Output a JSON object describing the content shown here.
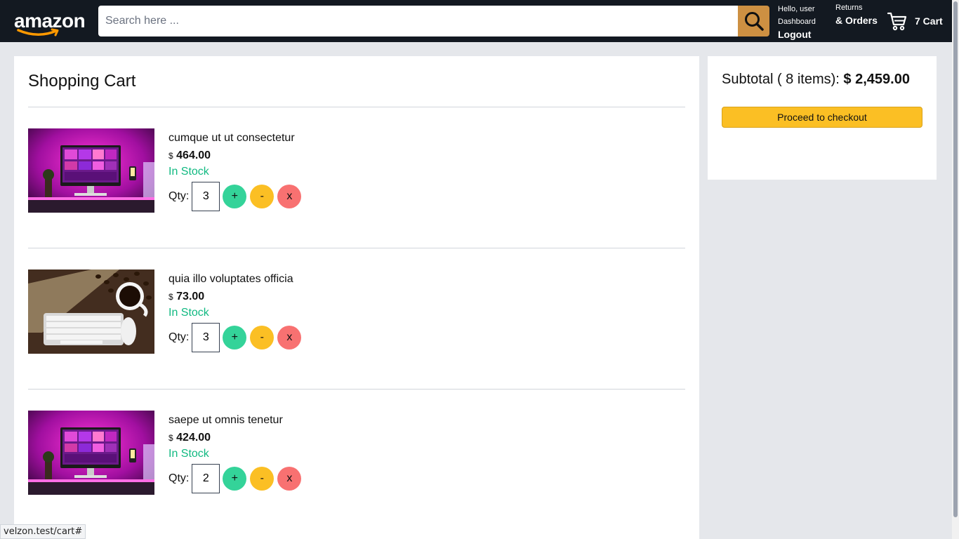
{
  "header": {
    "logo_text": "amazon",
    "search": {
      "placeholder": "Search here ...",
      "value": ""
    },
    "account": {
      "greeting": "Hello, user",
      "dashboard": "Dashboard",
      "logout": "Logout"
    },
    "returns": {
      "line1": "Returns",
      "line2": "& Orders"
    },
    "cart": {
      "label": "7 Cart"
    },
    "colors": {
      "background": "#131921",
      "search_button": "#cd9042"
    }
  },
  "cart": {
    "title": "Shopping Cart",
    "qty_label": "Qty:",
    "currency": "$",
    "buttons": {
      "plus": "+",
      "minus": "-",
      "remove": "x"
    },
    "items": [
      {
        "name": "cumque ut ut consectetur",
        "price": "464.00",
        "stock": "In Stock",
        "qty": "3",
        "image": "desk-setup-pink-image"
      },
      {
        "name": "quia illo voluptates officia",
        "price": "73.00",
        "stock": "In Stock",
        "qty": "3",
        "image": "keyboard-coffee-image"
      },
      {
        "name": "saepe ut omnis tenetur",
        "price": "424.00",
        "stock": "In Stock",
        "qty": "2",
        "image": "desk-setup-pink-image"
      }
    ]
  },
  "summary": {
    "subtotal_prefix": "Subtotal ( 8 items):",
    "subtotal_amount": "$ 2,459.00",
    "checkout_label": "Proceed to checkout"
  },
  "status_bar": {
    "url": "velzon.test/cart#"
  }
}
